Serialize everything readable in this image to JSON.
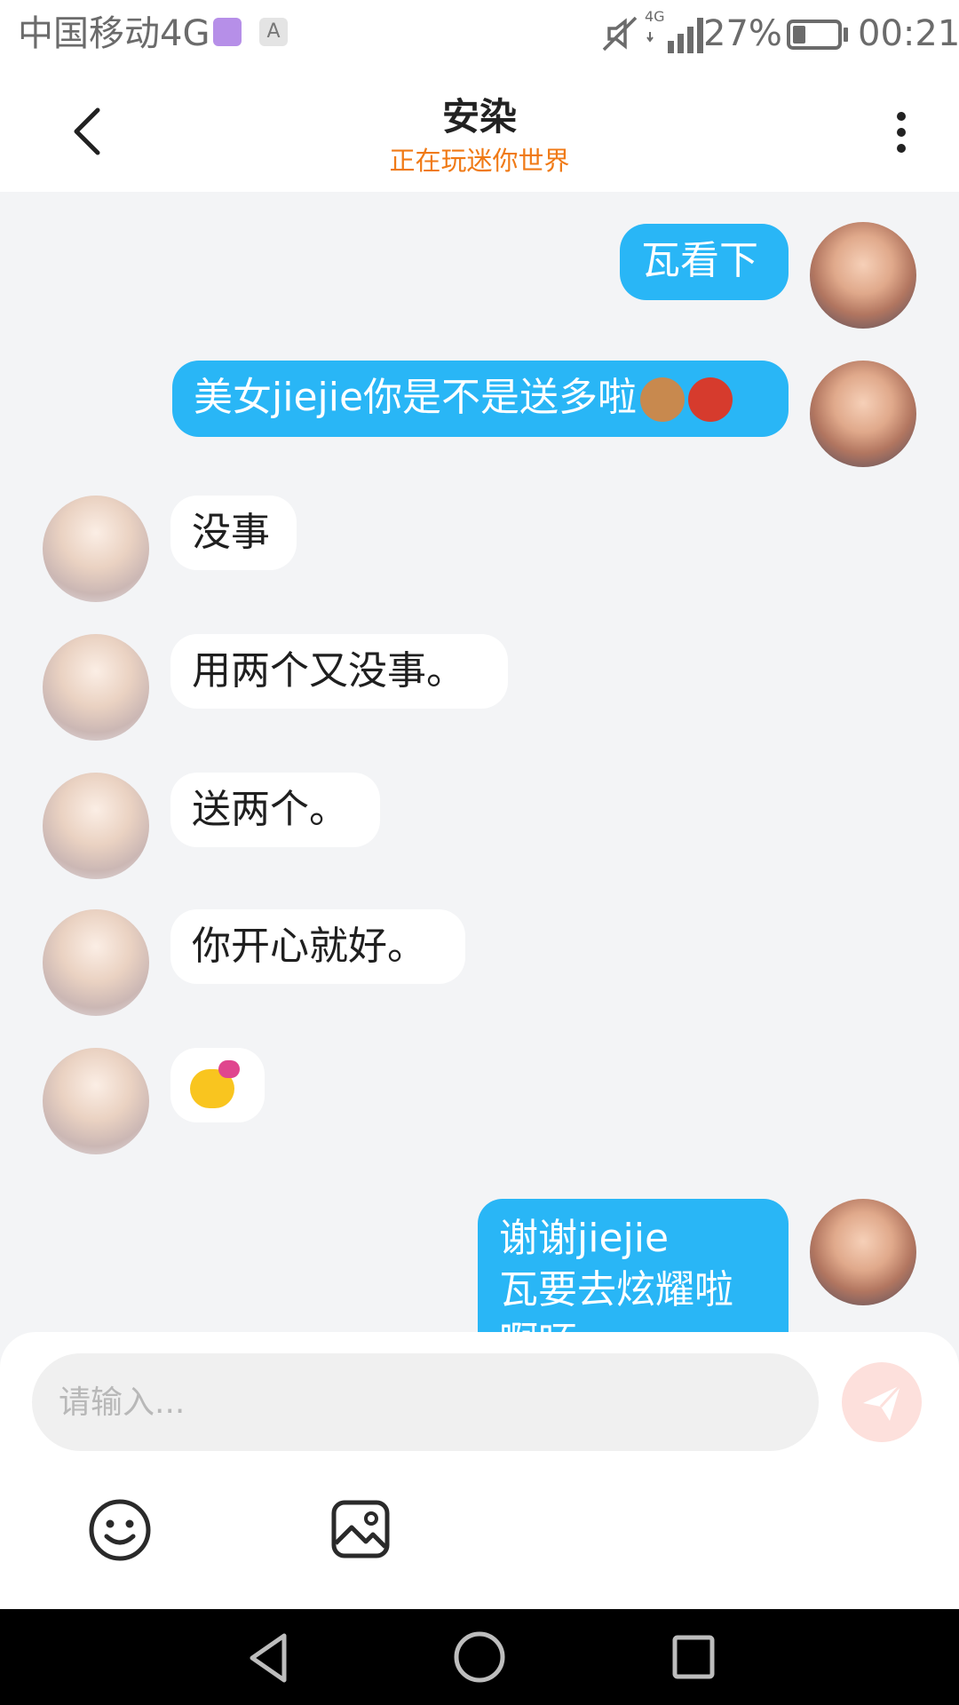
{
  "status_bar": {
    "carrier": "中国移动4G",
    "app_icon_a": "A",
    "network": "4G",
    "battery": "27%",
    "time": "00:21"
  },
  "header": {
    "title": "安染",
    "status": "正在玩迷你世界"
  },
  "messages": [
    {
      "from": "me",
      "text": "瓦看下"
    },
    {
      "from": "me",
      "text": "美女jiejie你是不是送多啦",
      "emojis": [
        "monkey",
        "rose"
      ]
    },
    {
      "from": "her",
      "text": "没事"
    },
    {
      "from": "her",
      "text": "用两个又没事。"
    },
    {
      "from": "her",
      "text": "送两个。"
    },
    {
      "from": "her",
      "text": "你开心就好。"
    },
    {
      "from": "her",
      "emoji": "kissing-heart-face"
    },
    {
      "from": "me",
      "text": "谢谢jiejie",
      "text2": "瓦要去炫耀啦",
      "text3": "啊呸"
    }
  ],
  "input": {
    "placeholder": "请输入..."
  },
  "colors": {
    "bubble_me": "#29b6f6",
    "bubble_her": "#ffffff",
    "accent_status": "#f07a16",
    "send_button": "#fde0dc"
  }
}
